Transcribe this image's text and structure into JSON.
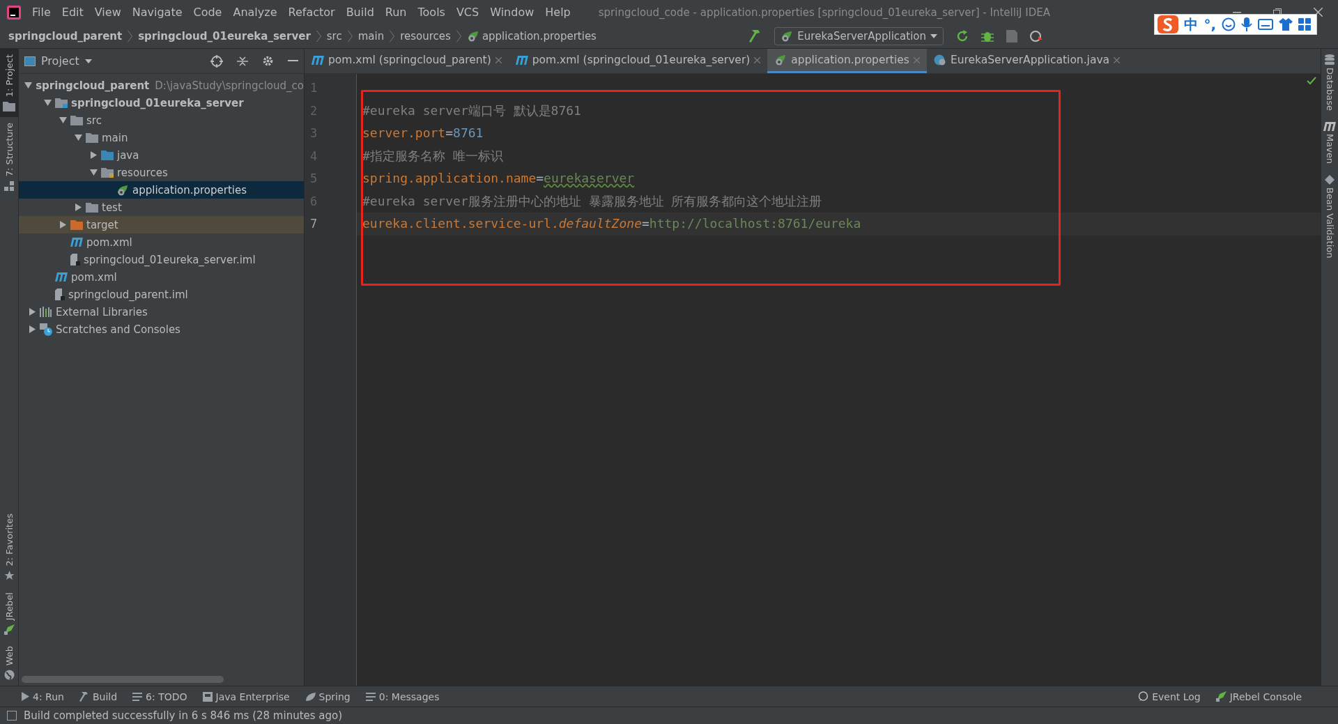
{
  "window": {
    "title": "springcloud_code - application.properties [springcloud_01eureka_server] - IntelliJ IDEA"
  },
  "menu": [
    "File",
    "Edit",
    "View",
    "Navigate",
    "Code",
    "Analyze",
    "Refactor",
    "Build",
    "Run",
    "Tools",
    "VCS",
    "Window",
    "Help"
  ],
  "breadcrumbs": [
    {
      "label": "springcloud_parent",
      "bold": true,
      "kind": "text"
    },
    {
      "label": "springcloud_01eureka_server",
      "bold": true,
      "kind": "text"
    },
    {
      "label": "src",
      "bold": false,
      "kind": "text"
    },
    {
      "label": "main",
      "bold": false,
      "kind": "text"
    },
    {
      "label": "resources",
      "bold": false,
      "kind": "text"
    },
    {
      "label": "application.properties",
      "bold": false,
      "kind": "properties"
    }
  ],
  "run_config": "EurekaServerApplication",
  "ime": {
    "mode": "中",
    "punct": "°,"
  },
  "project_panel": {
    "title": "Project"
  },
  "tree": [
    {
      "label": "springcloud_parent",
      "path": "D:\\javaStudy\\springcloud_co",
      "kind": "module",
      "bold": true,
      "expanded": true,
      "selected": false,
      "children": [
        {
          "label": "springcloud_01eureka_server",
          "kind": "module",
          "bold": true,
          "expanded": true,
          "selected": false,
          "children": [
            {
              "label": "src",
              "kind": "folder",
              "expanded": true,
              "selected": false,
              "children": [
                {
                  "label": "main",
                  "kind": "folder",
                  "expanded": true,
                  "selected": false,
                  "children": [
                    {
                      "label": "java",
                      "kind": "source",
                      "expanded": false,
                      "selected": false
                    },
                    {
                      "label": "resources",
                      "kind": "resource",
                      "expanded": true,
                      "selected": false,
                      "children": [
                        {
                          "label": "application.properties",
                          "kind": "properties",
                          "selected": true
                        }
                      ]
                    }
                  ]
                },
                {
                  "label": "test",
                  "kind": "folder",
                  "expanded": false,
                  "selected": false
                }
              ]
            },
            {
              "label": "target",
              "kind": "excluded",
              "expanded": false,
              "selected": false
            },
            {
              "label": "pom.xml",
              "kind": "maven",
              "selected": false
            },
            {
              "label": "springcloud_01eureka_server.iml",
              "kind": "iml",
              "selected": false
            }
          ]
        },
        {
          "label": "pom.xml",
          "kind": "maven",
          "selected": false
        },
        {
          "label": "springcloud_parent.iml",
          "kind": "iml",
          "selected": false
        }
      ]
    },
    {
      "label": "External Libraries",
      "kind": "libraries",
      "expanded": false,
      "selected": false
    },
    {
      "label": "Scratches and Consoles",
      "kind": "scratches",
      "expanded": false,
      "selected": false
    }
  ],
  "editor_tabs": [
    {
      "label": "pom.xml (springcloud_parent)",
      "kind": "maven",
      "selected": false
    },
    {
      "label": "pom.xml (springcloud_01eureka_server)",
      "kind": "maven",
      "selected": false
    },
    {
      "label": "application.properties",
      "kind": "properties",
      "selected": true
    },
    {
      "label": "EurekaServerApplication.java",
      "kind": "java",
      "selected": false
    }
  ],
  "editor": {
    "lines": [
      {
        "number": "1",
        "current": false
      },
      {
        "number": "2",
        "current": false,
        "tokens": [
          {
            "text": "#eureka server端口号 默认是8761",
            "kind": "comment"
          }
        ]
      },
      {
        "number": "3",
        "current": false,
        "tokens": [
          {
            "text": "server.port",
            "kind": "key"
          },
          {
            "text": "=",
            "kind": "op"
          },
          {
            "text": "8761",
            "kind": "number"
          }
        ]
      },
      {
        "number": "4",
        "current": false,
        "tokens": [
          {
            "text": "#指定服务名称 唯一标识",
            "kind": "comment"
          }
        ]
      },
      {
        "number": "5",
        "current": false,
        "tokens": [
          {
            "text": "spring.application.name",
            "kind": "key"
          },
          {
            "text": "=",
            "kind": "op"
          },
          {
            "text": "eurekaserver",
            "kind": "typo"
          }
        ]
      },
      {
        "number": "6",
        "current": false,
        "tokens": [
          {
            "text": "#eureka server服务注册中心的地址 暴露服务地址 所有服务都向这个地址注册",
            "kind": "comment"
          }
        ]
      },
      {
        "number": "7",
        "current": true,
        "tokens": [
          {
            "text": "eureka.client.service-url.",
            "kind": "key"
          },
          {
            "text": "defaultZone",
            "kind": "italic"
          },
          {
            "text": "=",
            "kind": "op"
          },
          {
            "text": "http://localhost:8761/eureka",
            "kind": "value"
          }
        ]
      }
    ]
  },
  "left_tools": [
    {
      "label": "1: Project",
      "selected": true,
      "kind": "folder"
    },
    {
      "label": "7: Structure",
      "selected": false,
      "kind": "structure"
    }
  ],
  "left_tools_bottom": [
    {
      "label": "2: Favorites",
      "selected": false,
      "kind": "star"
    },
    {
      "label": "JRebel",
      "selected": false,
      "kind": "rocket"
    },
    {
      "label": "Web",
      "selected": false,
      "kind": "globe"
    }
  ],
  "right_tools": [
    {
      "label": "Database",
      "kind": "database"
    },
    {
      "label": "Maven",
      "kind": "maven"
    },
    {
      "label": "Bean Validation",
      "kind": "bean"
    }
  ],
  "bottom_tools": [
    {
      "label": "4: Run",
      "kind": "run"
    },
    {
      "label": "Build",
      "kind": "hammer"
    },
    {
      "label": "6: TODO",
      "kind": "list"
    },
    {
      "label": "Java Enterprise",
      "kind": "jee"
    },
    {
      "label": "Spring",
      "kind": "leaf"
    },
    {
      "label": "0: Messages",
      "kind": "list"
    }
  ],
  "bottom_tools_right": [
    {
      "label": "Event Log",
      "kind": "bubble"
    },
    {
      "label": "JRebel Console",
      "kind": "rocket"
    }
  ],
  "status": "Build completed successfully in 6 s 846 ms (28 minutes ago)"
}
